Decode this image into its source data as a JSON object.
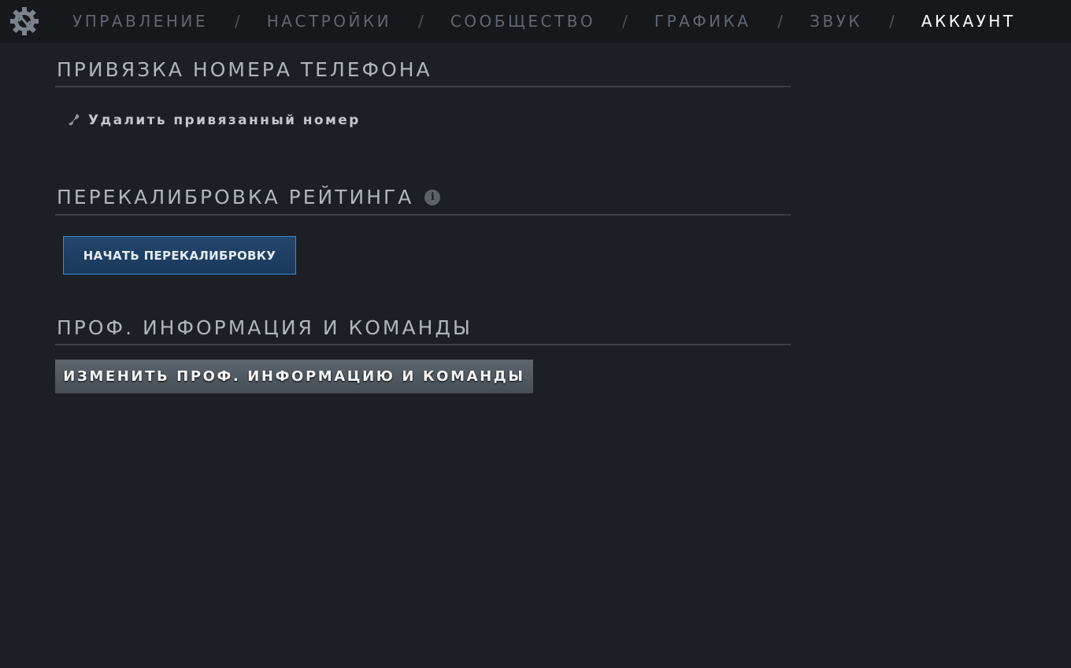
{
  "nav": {
    "logo_icon": "gear-icon",
    "tabs": [
      {
        "label": "УПРАВЛЕНИЕ",
        "active": false
      },
      {
        "label": "НАСТРОЙКИ",
        "active": false
      },
      {
        "label": "СООБЩЕСТВО",
        "active": false
      },
      {
        "label": "ГРАФИКА",
        "active": false
      },
      {
        "label": "ЗВУК",
        "active": false
      },
      {
        "label": "АККАУНТ",
        "active": true
      }
    ],
    "separator": "/"
  },
  "phone_section": {
    "title": "ПРИВЯЗКА НОМЕРА ТЕЛЕФОНА",
    "icon": "phone-icon",
    "remove_link": "Удалить привязанный номер"
  },
  "recalibration_section": {
    "title": "ПЕРЕКАЛИБРОВКА РЕЙТИНГА",
    "info_icon": "info-icon",
    "button_label": "НАЧАТЬ ПЕРЕКАЛИБРОВКУ"
  },
  "pro_section": {
    "title": "ПРОФ. ИНФОРМАЦИЯ И КОМАНДЫ",
    "button_label": "ИЗМЕНИТЬ ПРОФ. ИНФОРМАЦИЮ И КОМАНДЫ"
  },
  "colors": {
    "background": "#1c1f23",
    "topbar": "#16181b",
    "active_tab": "#ffffff",
    "inactive_tab": "#5f676f",
    "primary_button_border": "#3a8ad6"
  }
}
